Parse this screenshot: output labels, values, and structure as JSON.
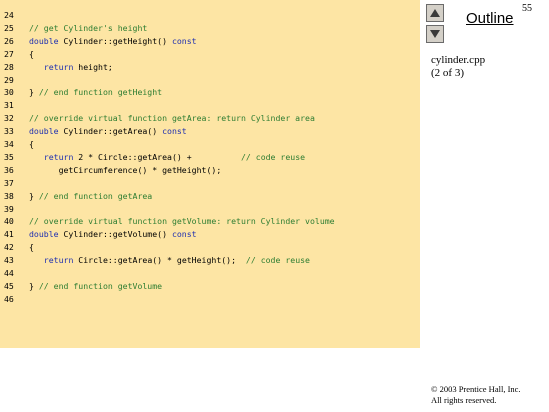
{
  "slide_number": "55",
  "outline": {
    "label": "Outline",
    "file_name": "cylinder.cpp",
    "page_of": "(2 of 3)",
    "up_icon": "triangle-up-icon",
    "down_icon": "triangle-down-icon"
  },
  "colors": {
    "code_background": "#fde5a4",
    "comment": "#2e7d32",
    "keyword": "#1f2fb0",
    "plain": "#000000"
  },
  "code": {
    "lines": [
      {
        "num": "24",
        "segments": []
      },
      {
        "num": "25",
        "segments": [
          {
            "t": "// get Cylinder's height",
            "k": "comment"
          }
        ]
      },
      {
        "num": "26",
        "segments": [
          {
            "t": "double",
            "k": "keyword"
          },
          {
            "t": " Cylinder::getHeight() ",
            "k": "plain"
          },
          {
            "t": "const",
            "k": "keyword"
          }
        ]
      },
      {
        "num": "27",
        "segments": [
          {
            "t": "{",
            "k": "plain"
          }
        ]
      },
      {
        "num": "28",
        "segments": [
          {
            "t": "   ",
            "k": "plain"
          },
          {
            "t": "return",
            "k": "keyword"
          },
          {
            "t": " height;",
            "k": "plain"
          }
        ]
      },
      {
        "num": "29",
        "segments": []
      },
      {
        "num": "30",
        "segments": [
          {
            "t": "} ",
            "k": "plain"
          },
          {
            "t": "// end function getHeight",
            "k": "comment"
          }
        ]
      },
      {
        "num": "31",
        "segments": []
      },
      {
        "num": "32",
        "segments": [
          {
            "t": "// override virtual function getArea: return Cylinder area",
            "k": "comment"
          }
        ]
      },
      {
        "num": "33",
        "segments": [
          {
            "t": "double",
            "k": "keyword"
          },
          {
            "t": " Cylinder::getArea() ",
            "k": "plain"
          },
          {
            "t": "const",
            "k": "keyword"
          }
        ]
      },
      {
        "num": "34",
        "segments": [
          {
            "t": "{",
            "k": "plain"
          }
        ]
      },
      {
        "num": "35",
        "segments": [
          {
            "t": "   ",
            "k": "plain"
          },
          {
            "t": "return",
            "k": "keyword"
          },
          {
            "t": " 2 * Circle::getArea() +          ",
            "k": "plain"
          },
          {
            "t": "// code reuse",
            "k": "comment"
          }
        ]
      },
      {
        "num": "36",
        "segments": [
          {
            "t": "      getCircumference() * getHeight();",
            "k": "plain"
          }
        ]
      },
      {
        "num": "37",
        "segments": []
      },
      {
        "num": "38",
        "segments": [
          {
            "t": "} ",
            "k": "plain"
          },
          {
            "t": "// end function getArea",
            "k": "comment"
          }
        ]
      },
      {
        "num": "39",
        "segments": []
      },
      {
        "num": "40",
        "segments": [
          {
            "t": "// override virtual function getVolume: return Cylinder volume",
            "k": "comment"
          }
        ]
      },
      {
        "num": "41",
        "segments": [
          {
            "t": "double",
            "k": "keyword"
          },
          {
            "t": " Cylinder::getVolume() ",
            "k": "plain"
          },
          {
            "t": "const",
            "k": "keyword"
          }
        ]
      },
      {
        "num": "42",
        "segments": [
          {
            "t": "{",
            "k": "plain"
          }
        ]
      },
      {
        "num": "43",
        "segments": [
          {
            "t": "   ",
            "k": "plain"
          },
          {
            "t": "return",
            "k": "keyword"
          },
          {
            "t": " Circle::getArea() * getHeight();  ",
            "k": "plain"
          },
          {
            "t": "// code reuse",
            "k": "comment"
          }
        ]
      },
      {
        "num": "44",
        "segments": []
      },
      {
        "num": "45",
        "segments": [
          {
            "t": "} ",
            "k": "plain"
          },
          {
            "t": "// end function getVolume",
            "k": "comment"
          }
        ]
      },
      {
        "num": "46",
        "segments": []
      }
    ]
  },
  "copyright": {
    "line1": "© 2003 Prentice Hall, Inc.",
    "line2": "All rights reserved."
  }
}
